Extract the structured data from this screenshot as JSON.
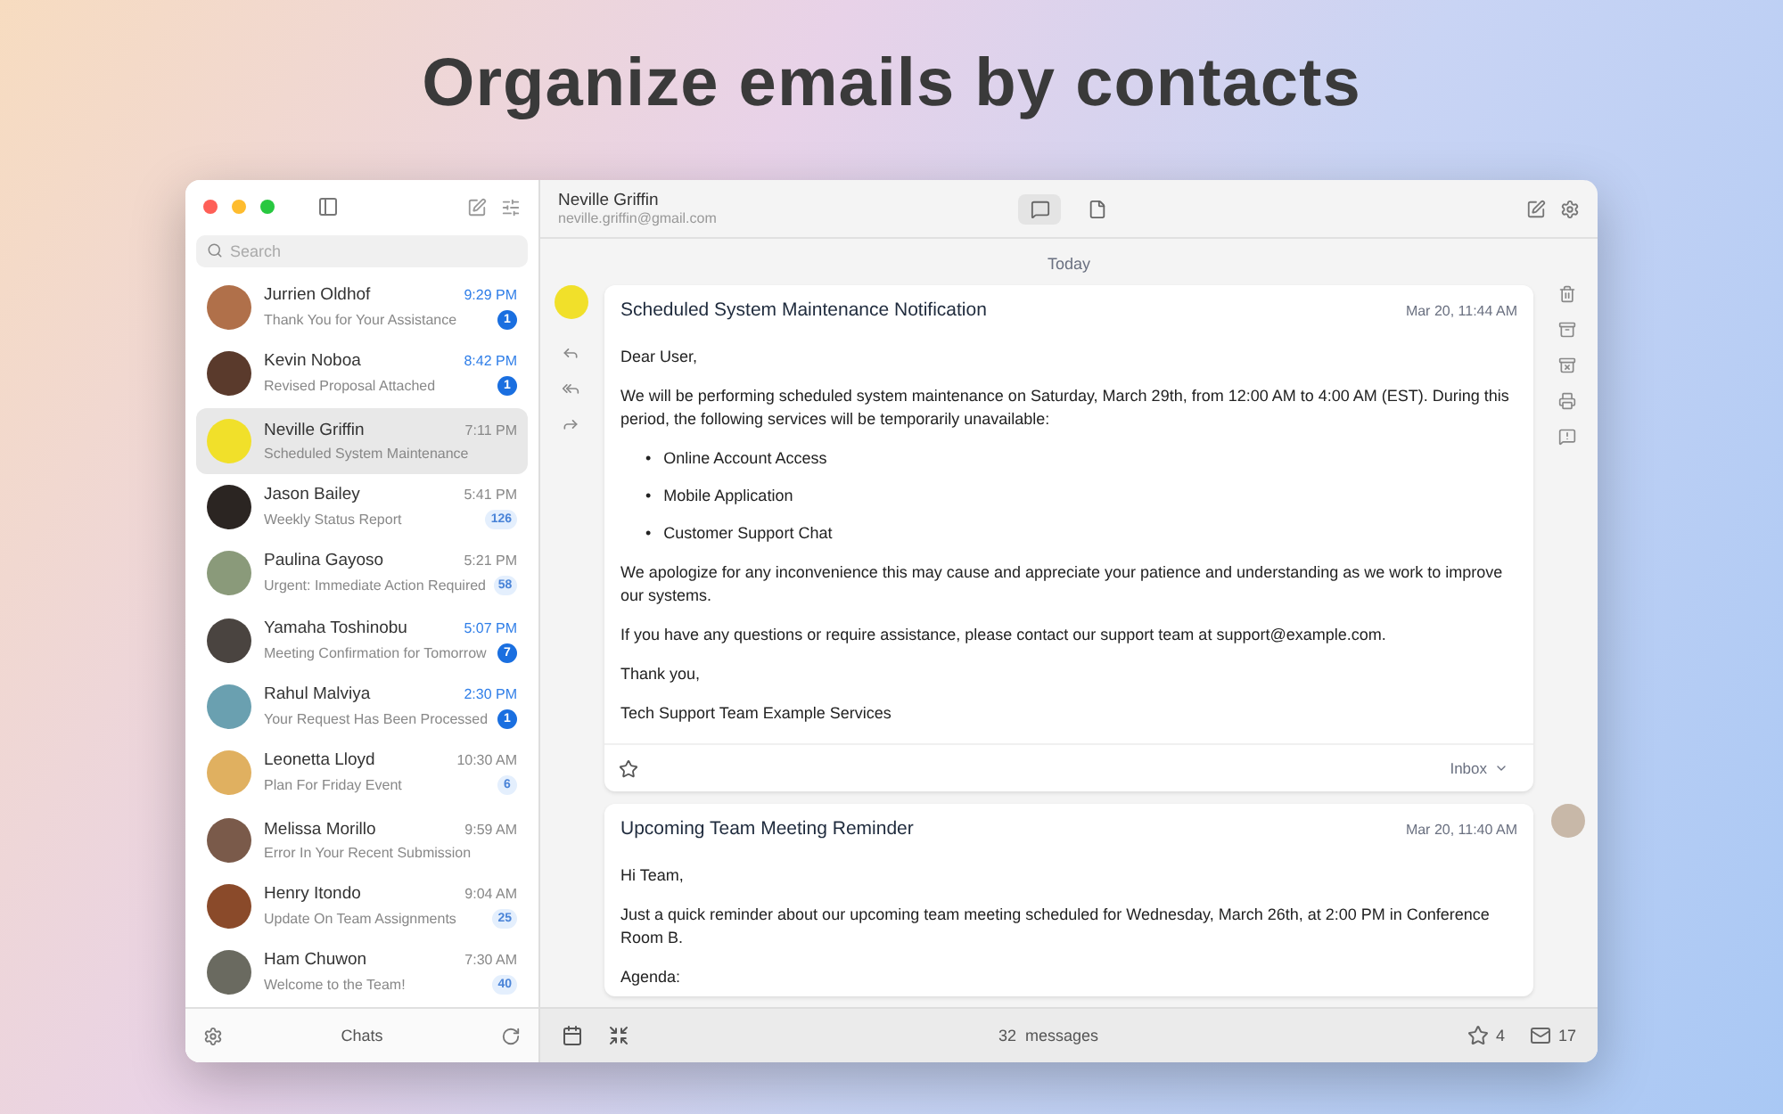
{
  "headline": "Organize emails by contacts",
  "sidebar": {
    "search": {
      "placeholder": "Search"
    },
    "contacts": [
      {
        "name": "Jurrien Oldhof",
        "preview": "Thank You for Your Assistance",
        "time": "9:29 PM",
        "count": "1",
        "unread": true,
        "selected": false,
        "color": "#b0704a"
      },
      {
        "name": "Kevin Noboa",
        "preview": "Revised Proposal Attached",
        "time": "8:42 PM",
        "count": "1",
        "unread": true,
        "selected": false,
        "color": "#5a3a2c"
      },
      {
        "name": "Neville Griffin",
        "preview": "Scheduled System Maintenance",
        "time": "7:11 PM",
        "unread": false,
        "selected": true,
        "color": "#f1e02a"
      },
      {
        "name": "Jason Bailey",
        "preview": "Weekly Status Report",
        "time": "5:41 PM",
        "count": "126",
        "unread": false,
        "selected": false,
        "color": "#2b2522"
      },
      {
        "name": "Paulina Gayoso",
        "preview": "Urgent: Immediate Action Required",
        "time": "5:21 PM",
        "count": "58",
        "unread": false,
        "selected": false,
        "color": "#8a9a7a"
      },
      {
        "name": "Yamaha Toshinobu",
        "preview": "Meeting Confirmation for Tomorrow",
        "time": "5:07 PM",
        "count": "7",
        "unread": true,
        "selected": false,
        "color": "#4a4440"
      },
      {
        "name": "Rahul Malviya",
        "preview": "Your Request Has Been Processed",
        "time": "2:30 PM",
        "count": "1",
        "unread": true,
        "selected": false,
        "color": "#6aa0b0"
      },
      {
        "name": "Leonetta Lloyd",
        "preview": "Plan For Friday Event",
        "time": "10:30 AM",
        "count": "6",
        "unread": false,
        "selected": false,
        "color": "#e0b060"
      },
      {
        "name": "Melissa Morillo",
        "preview": "Error In Your Recent Submission",
        "time": "9:59 AM",
        "unread": false,
        "selected": false,
        "color": "#7a5a4a"
      },
      {
        "name": "Henry Itondo",
        "preview": "Update On Team Assignments",
        "time": "9:04 AM",
        "count": "25",
        "unread": false,
        "selected": false,
        "color": "#8a4a2a"
      },
      {
        "name": "Ham Chuwon",
        "preview": "Welcome to the Team!",
        "time": "7:30 AM",
        "count": "40",
        "unread": false,
        "selected": false,
        "color": "#6a6a60"
      }
    ],
    "footer_label": "Chats"
  },
  "header": {
    "name": "Neville Griffin",
    "email": "neville.griffin@gmail.com",
    "view_tabs": [
      {
        "kind": "chat",
        "selected": true
      },
      {
        "kind": "document",
        "selected": false
      }
    ]
  },
  "day_label": "Today",
  "messages": [
    {
      "kind": "incoming",
      "subject": "Scheduled System Maintenance Notification",
      "date": "Mar 20, 11:44 AM",
      "body": [
        {
          "kind": "p",
          "text": "Dear User,"
        },
        {
          "kind": "p",
          "text": "We will be performing scheduled system maintenance on Saturday, March 29th, from 12:00 AM to 4:00 AM (EST). During this period, the following services will be temporarily unavailable:"
        },
        {
          "kind": "list",
          "marker": "•",
          "items": [
            "Online Account Access",
            "Mobile Application",
            "Customer Support Chat"
          ]
        },
        {
          "kind": "p",
          "text": "We apologize for any inconvenience this may cause and appreciate your patience and understanding as we work to improve our systems."
        },
        {
          "kind": "p",
          "text": "If you have any questions or require assistance, please contact our support team at support@example.com."
        },
        {
          "kind": "p",
          "text": "Thank you,"
        },
        {
          "kind": "p",
          "text": "Tech Support Team Example Services"
        }
      ],
      "footer": {
        "starred": false,
        "folder": "Inbox"
      }
    },
    {
      "kind": "outgoing",
      "subject": "Upcoming Team Meeting Reminder",
      "date": "Mar 20, 11:40 AM",
      "body": [
        {
          "kind": "p",
          "text": "Hi Team,"
        },
        {
          "kind": "p",
          "text": "Just a quick reminder about our upcoming team meeting scheduled for Wednesday, March 26th, at 2:00 PM in Conference Room B."
        },
        {
          "kind": "p",
          "text": "Agenda:"
        }
      ]
    }
  ],
  "status_bar": {
    "count": "32",
    "label": "messages",
    "starred": "4",
    "mail": "17"
  }
}
